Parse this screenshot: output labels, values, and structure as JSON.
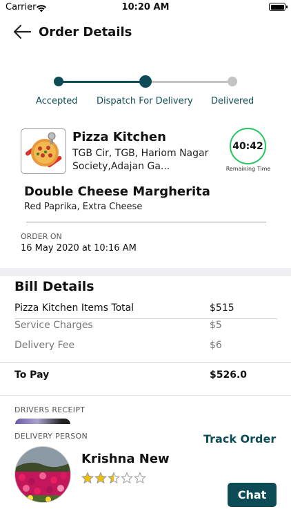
{
  "status_bar": {
    "carrier": "Carrier",
    "time": "10:20 AM",
    "wifi_icon": "wifi-icon",
    "battery_icon": "battery-icon"
  },
  "header": {
    "back_icon": "arrow-left-icon",
    "title": "Order Details"
  },
  "progress": {
    "active_color": "#0d4c56",
    "inactive_color": "#c4c4c4",
    "steps": [
      {
        "label": "Accepted",
        "state": "done"
      },
      {
        "label": "Dispatch For Delivery",
        "state": "current"
      },
      {
        "label": "Delivered",
        "state": "pending"
      }
    ]
  },
  "restaurant": {
    "name": "Pizza Kitchen",
    "address": "TGB Cir, TGB, Hariom Nagar Society,Adajan Ga...",
    "image_icon": "pizza-icon"
  },
  "timer": {
    "value": "40:42",
    "caption": "Remaining Time",
    "ring_color": "#22c55e"
  },
  "item": {
    "name": "Double Cheese Margherita",
    "extras": "Red Paprika, Extra Cheese"
  },
  "order": {
    "label": "ORDER ON",
    "date": "16 May 2020 at 10:16 AM"
  },
  "bill": {
    "title": "Bill Details",
    "rows": [
      {
        "label": "Pizza Kitchen Items Total",
        "value": "$515"
      },
      {
        "label": "Service Charges",
        "value": "$5"
      },
      {
        "label": "Delivery Fee",
        "value": "$6"
      }
    ],
    "to_pay_label": "To Pay",
    "to_pay_value": "$526.0"
  },
  "drivers_receipt": {
    "label": "DRIVERS RECEIPT"
  },
  "delivery": {
    "label": "DELIVERY PERSON",
    "track_label": "Track Order",
    "driver_name": "Krishna New",
    "rating": 2.5,
    "rating_max": 5,
    "star_color": "#f2c200",
    "chat_label": "Chat"
  }
}
